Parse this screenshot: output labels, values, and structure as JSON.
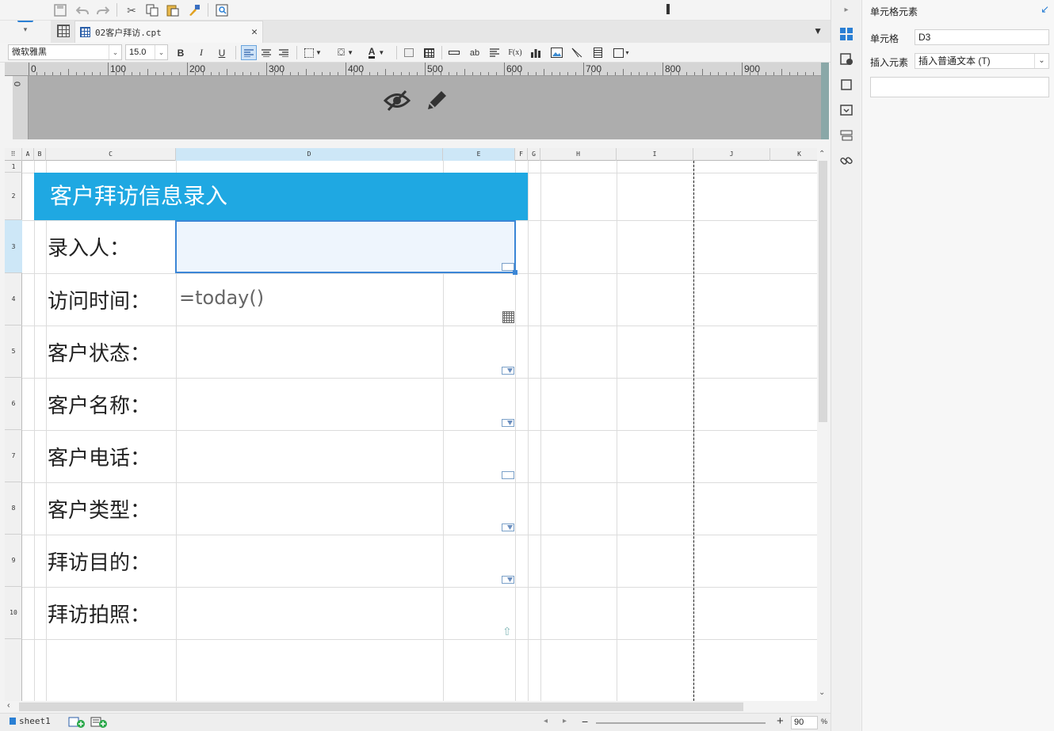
{
  "toolbar": {
    "icons": [
      "save-icon",
      "undo-icon",
      "redo-icon",
      "cut-icon",
      "copy-icon",
      "paste-icon",
      "format-painter-icon",
      "preview-icon"
    ]
  },
  "tab": {
    "file_name": "02客户拜访.cpt"
  },
  "format_bar": {
    "font_name": "微软雅黑",
    "font_size": "15.0",
    "bold": "B",
    "italic": "I",
    "underline": "U",
    "text_label": "ab",
    "formula_label": "F(x)",
    "font_color_label": "A"
  },
  "ruler": {
    "marks": [
      "0",
      "100",
      "200",
      "300",
      "400",
      "500",
      "600",
      "700",
      "800",
      "900"
    ],
    "vertical_zero": "0"
  },
  "grid": {
    "columns": [
      "A",
      "B",
      "C",
      "D",
      "E",
      "F",
      "G",
      "H",
      "I",
      "J",
      "K"
    ],
    "rows": [
      "1",
      "2",
      "3",
      "4",
      "5",
      "6",
      "7",
      "8",
      "9",
      "10"
    ],
    "title": "客户拜访信息录入",
    "labels": [
      "录入人：",
      "访问时间：",
      "客户状态：",
      "客户名称：",
      "客户电话：",
      "客户类型：",
      "拜访目的：",
      "拜访拍照："
    ],
    "formula": "=today()",
    "accent_color": "#1fa8e2",
    "selection_color": "#3b86d6"
  },
  "statusbar": {
    "sheet_name": "sheet1",
    "zoom_minus": "−",
    "zoom_plus": "+",
    "zoom_value": "90",
    "zoom_unit": "%"
  },
  "panel": {
    "title": "单元格元素",
    "cell_label": "单元格",
    "cell_value": "D3",
    "insert_label": "插入元素",
    "insert_value": "插入普通文本 (T)"
  }
}
